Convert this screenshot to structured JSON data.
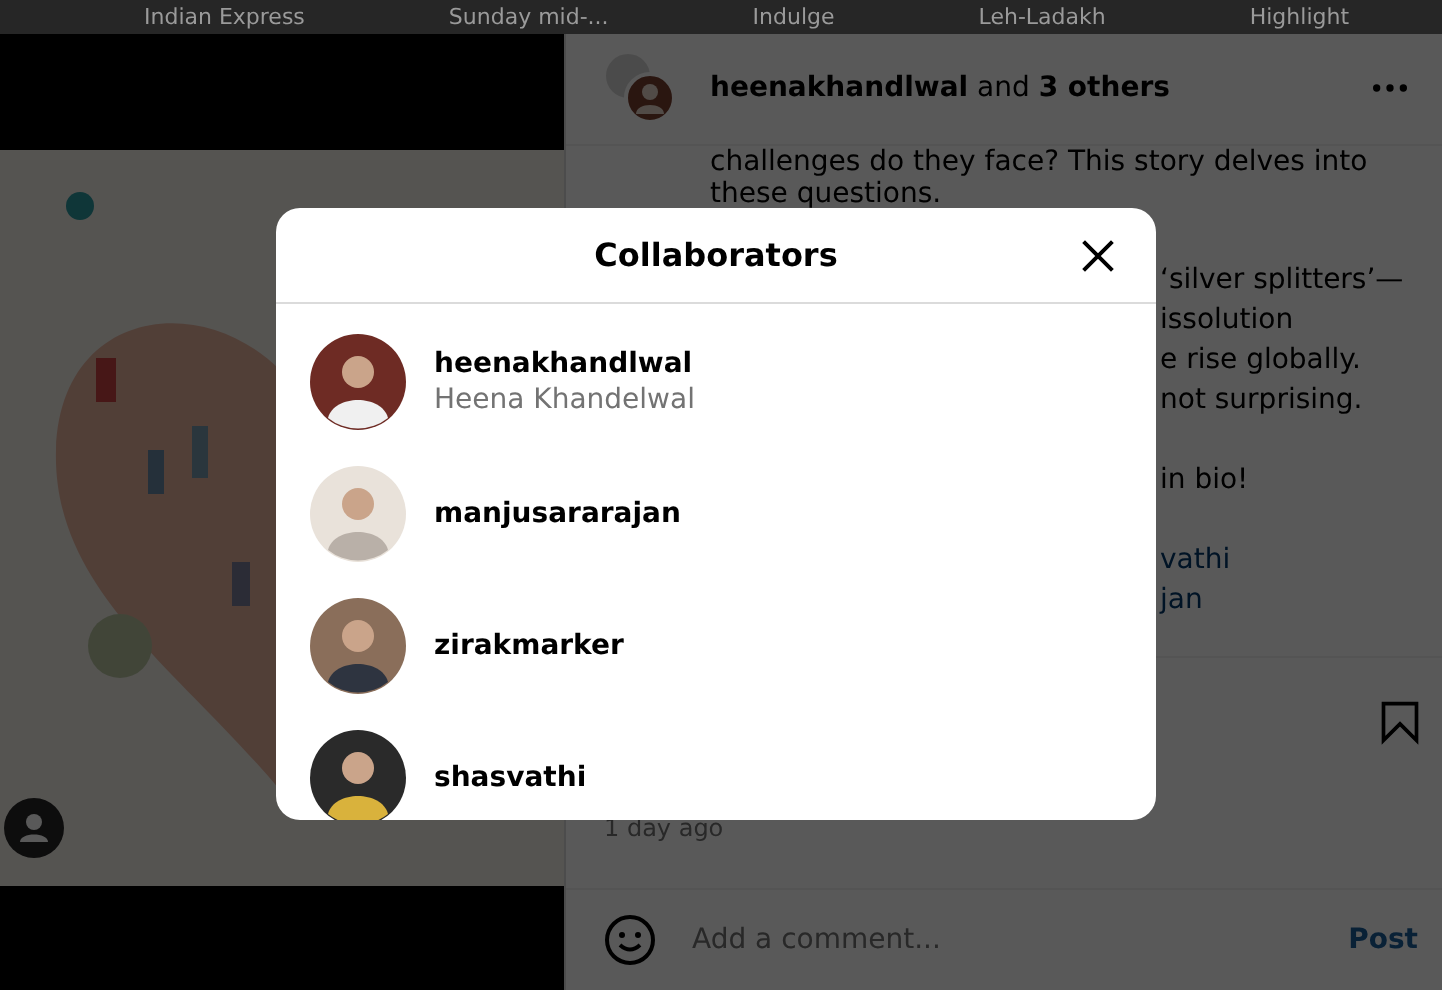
{
  "highlights": [
    "Indian Express",
    "Sunday mid-...",
    "Indulge",
    "Leh-Ladakh",
    "Highlight"
  ],
  "post": {
    "header": "**heenakhandlwal** and **3 others**",
    "caption_lines": [
      "challenges do they face? This story delves into",
      "these questions."
    ],
    "caption_fragments": [
      {
        "kind": "text",
        "text": "‘silver splitters’—"
      },
      {
        "kind": "text",
        "text": "issolution"
      },
      {
        "kind": "text",
        "text": "e rise globally."
      },
      {
        "kind": "text",
        "text": "not surprising."
      },
      {
        "kind": "gap"
      },
      {
        "kind": "text",
        "text": "in bio!"
      },
      {
        "kind": "gap"
      },
      {
        "kind": "link",
        "text": "vathi"
      },
      {
        "kind": "link",
        "text": "jan"
      }
    ],
    "saved": false,
    "time": "1 day ago",
    "comment": {
      "placeholder": "Add a comment..."
    },
    "post_button": {
      "label": "Post",
      "disabled": true
    }
  },
  "collaborators": {
    "title": "Collaborators",
    "people": [
      {
        "username": "heenakhandlwal",
        "full_name": "Heena Khandelwal"
      },
      {
        "username": "manjusararajan"
      },
      {
        "username": "zirakmarker"
      },
      {
        "username": "shasvathi"
      }
    ]
  }
}
